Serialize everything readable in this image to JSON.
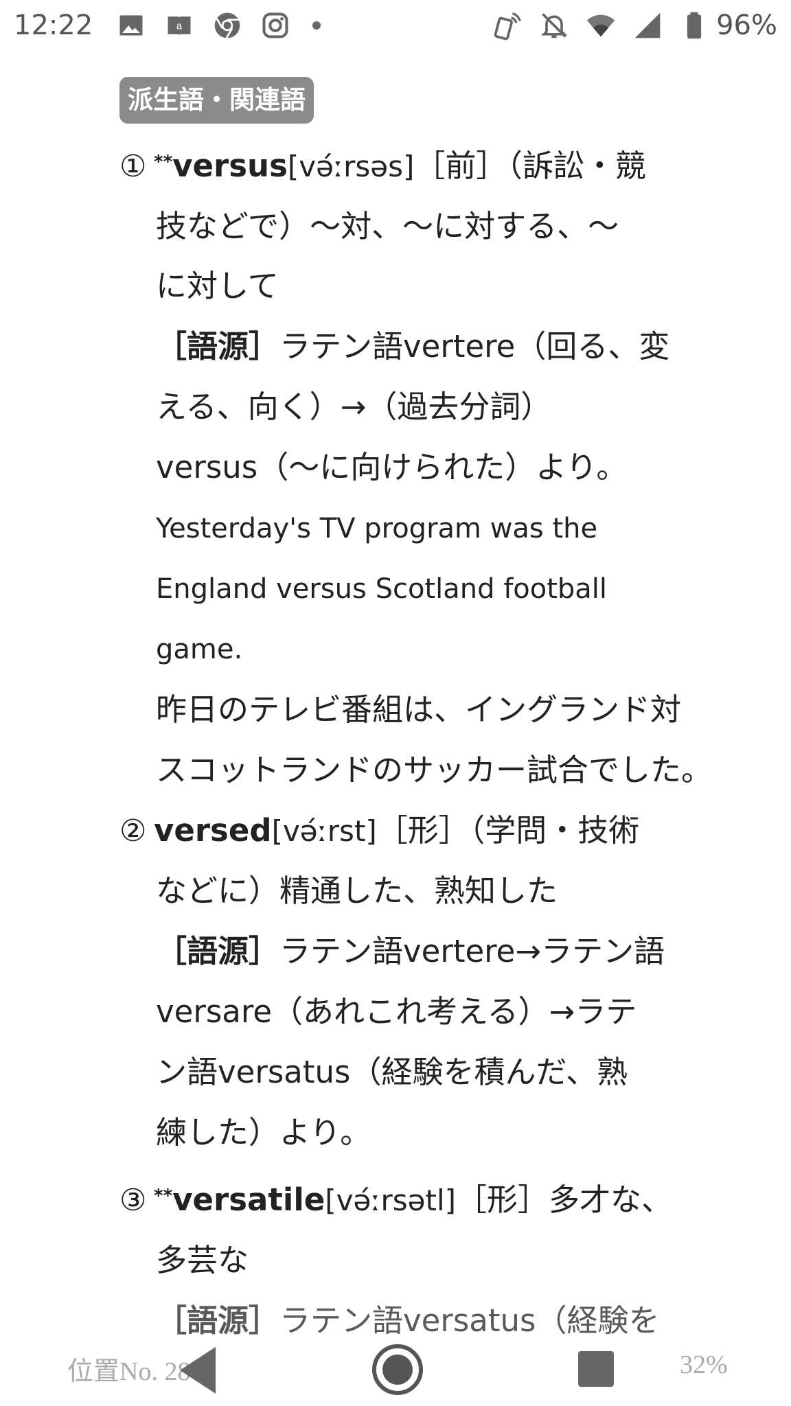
{
  "status_bar": {
    "time": "12:22",
    "icons_left": [
      "image-icon",
      "amazon-kindle-icon",
      "chrome-icon",
      "instagram-icon",
      "more-notifications-dot"
    ],
    "icons_right": [
      "nfc-phone-icon",
      "bell-muted-icon",
      "wifi-icon",
      "cellular-signal-icon",
      "battery-icon"
    ],
    "battery_percent": "96%"
  },
  "section": {
    "badge": "派生語・関連語"
  },
  "entries": [
    {
      "number": "①",
      "stars": "**",
      "word": "versus",
      "pronunciation": "[vә́ːrsәs]",
      "head_rest": "［前］（訴訟・競",
      "definition_lines": [
        "技などで）～対、～に対する、～",
        "に対して"
      ],
      "etymology_label": "［語源］",
      "etymology_first": "ラテン語vertere（回る、変",
      "etymology_lines": [
        "える、向く）→（過去分詞）",
        "versus（～に向けられた）より。"
      ],
      "example_en_lines": [
        "Yesterday's TV program was the",
        "England versus Scotland football",
        "game."
      ],
      "example_ja_lines": [
        "昨日のテレビ番組は、イングランド対",
        "スコットランドのサッカー試合でした。"
      ]
    },
    {
      "number": "②",
      "stars": "",
      "word": "versed",
      "pronunciation": "[vә́ːrst]",
      "head_rest": "［形］（学問・技術",
      "definition_lines": [
        "などに）精通した、熟知した"
      ],
      "etymology_label": "［語源］",
      "etymology_first": "ラテン語vertere→ラテン語",
      "etymology_lines": [
        "versare（あれこれ考える）→ラテ",
        "ン語versatus（経験を積んだ、熟",
        "練した）より。"
      ]
    },
    {
      "number": "③",
      "stars": "**",
      "word": "versatile",
      "pronunciation": "[vә́ːrsәtl]",
      "head_rest": "［形］多才な、",
      "definition_lines": [
        "多芸な"
      ],
      "etymology_label": "［語源］",
      "etymology_first": "ラテン語versatus（経験を"
    }
  ],
  "footer": {
    "location": "位置No. 2861",
    "progress": "32%"
  },
  "colors": {
    "badge_bg": "#8b8b8b",
    "text": "#222222",
    "footer_text": "#aaaaaa"
  }
}
